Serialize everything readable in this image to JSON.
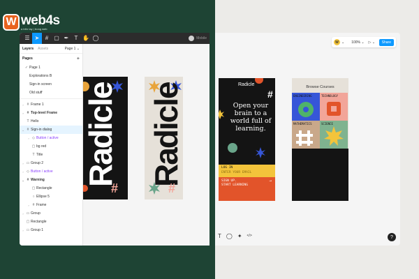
{
  "brand": {
    "logo_letter": "W",
    "name": "web4s",
    "tagline": "a trên tay | trong web"
  },
  "left_window": {
    "toolbar": {
      "icons": [
        "menu-icon",
        "move-icon",
        "frame-icon",
        "shape-icon",
        "pen-icon",
        "text-icon",
        "hand-icon",
        "comment-icon"
      ],
      "file_name": "Mobile"
    },
    "panel": {
      "tabs": [
        "Layers",
        "Assets"
      ],
      "page_select": "Page 1 ⌄",
      "pages_title": "Pages",
      "pages": [
        "Page 1",
        "Explorations B",
        "Sign-in screen",
        "Old stuff"
      ],
      "layers": [
        {
          "label": "Frame 1",
          "icon": "#",
          "caret": "›"
        },
        {
          "label": "Top-level Frame",
          "icon": "#",
          "caret": "›",
          "bold": true
        },
        {
          "label": "Hello",
          "icon": "T",
          "caret": ""
        },
        {
          "label": "Sign-in dialog",
          "icon": "#",
          "caret": "⌄",
          "hl": true
        },
        {
          "label": "Button / active",
          "icon": "◇",
          "caret": "›",
          "purple": true,
          "indent": 1
        },
        {
          "label": "bg red",
          "icon": "▢",
          "caret": "",
          "indent": 1
        },
        {
          "label": "Title",
          "icon": "T",
          "caret": "",
          "indent": 1
        },
        {
          "label": "Group 2",
          "icon": "▭",
          "caret": "›"
        },
        {
          "label": "Button / active",
          "icon": "◇",
          "caret": "›",
          "purple": true
        },
        {
          "label": "Warning",
          "icon": "#",
          "caret": "⌄",
          "bold": true
        },
        {
          "label": "Rectangle",
          "icon": "▢",
          "caret": "",
          "indent": 1
        },
        {
          "label": "Ellipse 5",
          "icon": "○",
          "caret": "",
          "indent": 1
        },
        {
          "label": "Frame",
          "icon": "#",
          "caret": "›",
          "indent": 1
        },
        {
          "label": "Group",
          "icon": "▭",
          "caret": "›"
        },
        {
          "label": "Rectangle",
          "icon": "▢",
          "caret": ""
        },
        {
          "label": "Group 1",
          "icon": "▭",
          "caret": "›"
        }
      ]
    },
    "phone1_word": "Radicle",
    "phone2_word": "Radicle",
    "hash_glyph": "#"
  },
  "right_window": {
    "topbar": {
      "avatar": "W",
      "zoom": "100% ⌄",
      "play": "▷ ⌄",
      "share": "Share"
    },
    "bottom_tools": [
      "T",
      "◯",
      "✦",
      "</>"
    ],
    "help": "?",
    "phone3": {
      "title": "Radicle",
      "headline": "Open your brain to a world full of learning.",
      "login": "LOG IN",
      "login_sub": "ENTER YOUR EMAIL",
      "signup": "SIGN UP.",
      "signup_sub": "START LEARNING",
      "arrow": "→"
    },
    "phone4": {
      "title": "Browse Courses",
      "tiles": [
        "ENGINEERING",
        "TECHNOLOGY",
        "MATHEMATICS",
        "SCIENCE"
      ]
    }
  },
  "colors": {
    "accent_blue": "#0d99ff",
    "yellow": "#f3c43b",
    "orange": "#e2542a",
    "dark": "#141414",
    "cream": "#e6e1d9"
  }
}
